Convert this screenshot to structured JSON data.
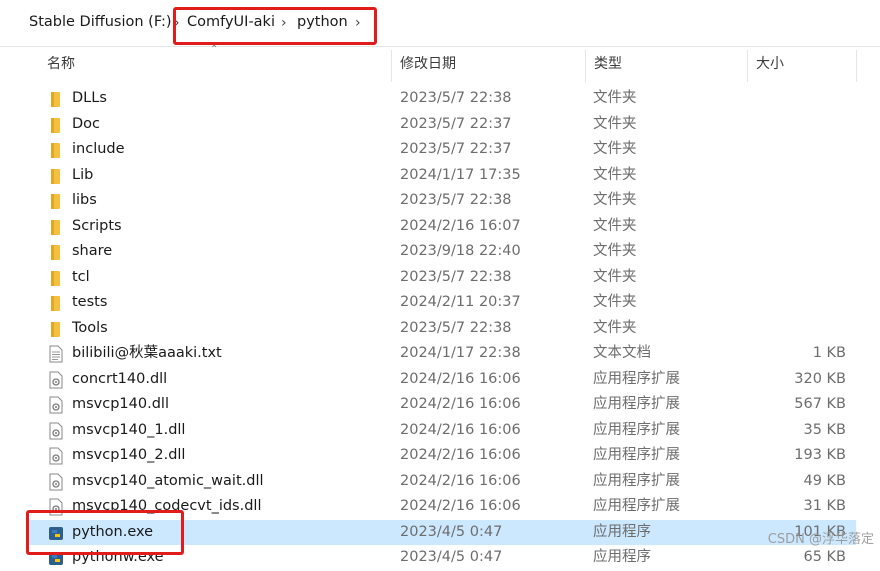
{
  "breadcrumb": {
    "items": [
      "Stable Diffusion (F:)",
      "ComfyUI-aki",
      "python"
    ]
  },
  "columns": {
    "name": "名称",
    "date": "修改日期",
    "type": "类型",
    "size": "大小"
  },
  "files": [
    {
      "name": "DLLs",
      "date": "2023/5/7 22:38",
      "type": "文件夹",
      "size": "",
      "icon": "folder-icon"
    },
    {
      "name": "Doc",
      "date": "2023/5/7 22:37",
      "type": "文件夹",
      "size": "",
      "icon": "folder-icon"
    },
    {
      "name": "include",
      "date": "2023/5/7 22:37",
      "type": "文件夹",
      "size": "",
      "icon": "folder-icon"
    },
    {
      "name": "Lib",
      "date": "2024/1/17 17:35",
      "type": "文件夹",
      "size": "",
      "icon": "folder-icon"
    },
    {
      "name": "libs",
      "date": "2023/5/7 22:38",
      "type": "文件夹",
      "size": "",
      "icon": "folder-icon"
    },
    {
      "name": "Scripts",
      "date": "2024/2/16 16:07",
      "type": "文件夹",
      "size": "",
      "icon": "folder-icon"
    },
    {
      "name": "share",
      "date": "2023/9/18 22:40",
      "type": "文件夹",
      "size": "",
      "icon": "folder-icon"
    },
    {
      "name": "tcl",
      "date": "2023/5/7 22:38",
      "type": "文件夹",
      "size": "",
      "icon": "folder-icon"
    },
    {
      "name": "tests",
      "date": "2024/2/11 20:37",
      "type": "文件夹",
      "size": "",
      "icon": "folder-icon"
    },
    {
      "name": "Tools",
      "date": "2023/5/7 22:38",
      "type": "文件夹",
      "size": "",
      "icon": "folder-icon"
    },
    {
      "name": "bilibili@秋葉aaaki.txt",
      "date": "2024/1/17 22:38",
      "type": "文本文档",
      "size": "1 KB",
      "icon": "text-file-icon"
    },
    {
      "name": "concrt140.dll",
      "date": "2024/2/16 16:06",
      "type": "应用程序扩展",
      "size": "320 KB",
      "icon": "dll-file-icon"
    },
    {
      "name": "msvcp140.dll",
      "date": "2024/2/16 16:06",
      "type": "应用程序扩展",
      "size": "567 KB",
      "icon": "dll-file-icon"
    },
    {
      "name": "msvcp140_1.dll",
      "date": "2024/2/16 16:06",
      "type": "应用程序扩展",
      "size": "35 KB",
      "icon": "dll-file-icon"
    },
    {
      "name": "msvcp140_2.dll",
      "date": "2024/2/16 16:06",
      "type": "应用程序扩展",
      "size": "193 KB",
      "icon": "dll-file-icon"
    },
    {
      "name": "msvcp140_atomic_wait.dll",
      "date": "2024/2/16 16:06",
      "type": "应用程序扩展",
      "size": "49 KB",
      "icon": "dll-file-icon"
    },
    {
      "name": "msvcp140_codecvt_ids.dll",
      "date": "2024/2/16 16:06",
      "type": "应用程序扩展",
      "size": "31 KB",
      "icon": "dll-file-icon"
    },
    {
      "name": "python.exe",
      "date": "2023/4/5 0:47",
      "type": "应用程序",
      "size": "101 KB",
      "icon": "python-exe-icon",
      "selected": true
    },
    {
      "name": "pythonw.exe",
      "date": "2023/4/5 0:47",
      "type": "应用程序",
      "size": "65 KB",
      "icon": "python-exe-icon"
    }
  ],
  "watermark": "CSDN @浮华落定",
  "colors": {
    "highlight_box": "#e21b1b",
    "selected_row": "#cce8ff",
    "folder": "#f4c042"
  }
}
